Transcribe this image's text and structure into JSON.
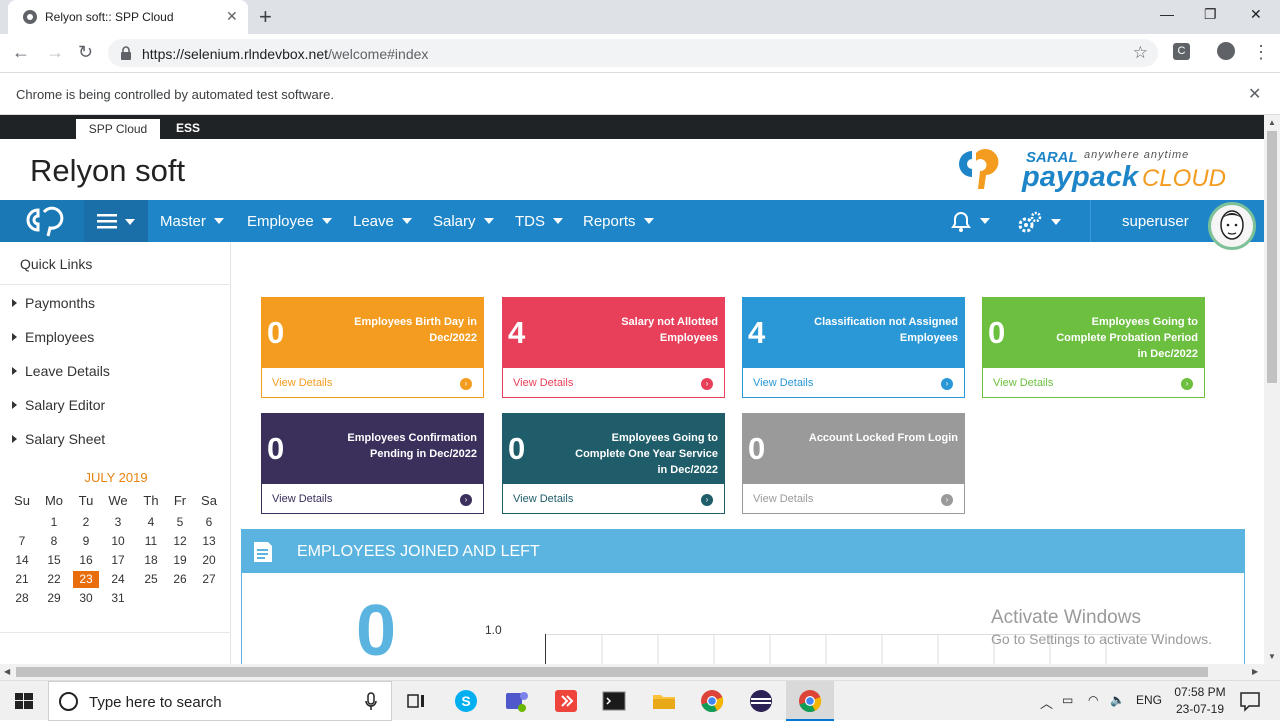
{
  "browser": {
    "tab_title": "Relyon soft:: SPP Cloud",
    "url_host": "https://selenium.rlndevbox.net",
    "url_path": "/welcome#index",
    "infobar_text": "Chrome is being controlled by automated test software."
  },
  "app": {
    "top_tabs": [
      "SPP Cloud",
      "ESS"
    ],
    "company_name": "Relyon soft",
    "logo_text": {
      "saral": "SARAL",
      "tagline": "anywhere anytime",
      "paypack": "paypack",
      "cloud": "CLOUD"
    },
    "menu": [
      "Master",
      "Employee",
      "Leave",
      "Salary",
      "TDS",
      "Reports"
    ],
    "username": "superuser"
  },
  "sidebar": {
    "title": "Quick Links",
    "items": [
      "Paymonths",
      "Employees",
      "Leave Details",
      "Salary Editor",
      "Salary Sheet"
    ],
    "calendar": {
      "month": "JULY 2019",
      "weekdays": [
        "Su",
        "Mo",
        "Tu",
        "We",
        "Th",
        "Fr",
        "Sa"
      ],
      "today": 23
    }
  },
  "cards": [
    {
      "value": "0",
      "label": "Employees Birth Day in Dec/2022",
      "link": "View Details",
      "color": "#f39c1f"
    },
    {
      "value": "4",
      "label": "Salary not Allotted Employees",
      "link": "View Details",
      "color": "#e8405a"
    },
    {
      "value": "4",
      "label": "Classification not Assigned Employees",
      "link": "View Details",
      "color": "#2a97d6"
    },
    {
      "value": "0",
      "label": "Employees Going to Complete Probation Period in Dec/2022",
      "link": "View Details",
      "color": "#6cbf3f"
    },
    {
      "value": "0",
      "label": "Employees Confirmation Pending in Dec/2022",
      "link": "View Details",
      "color": "#3b2f5c"
    },
    {
      "value": "0",
      "label": "Employees Going to Complete One Year Service in Dec/2022",
      "link": "View Details",
      "color": "#1f5d6a"
    },
    {
      "value": "0",
      "label": "Account Locked From Login",
      "link": "View Details",
      "color": "#9a9a9a"
    }
  ],
  "joined_panel": {
    "title": "EMPLOYEES JOINED AND LEFT",
    "count": "0",
    "y_tick": "1.0"
  },
  "watermark": {
    "line1": "Activate Windows",
    "line2": "Go to Settings to activate Windows."
  },
  "taskbar": {
    "search_placeholder": "Type here to search",
    "lang": "ENG",
    "time": "07:58 PM",
    "date": "23-07-19"
  }
}
